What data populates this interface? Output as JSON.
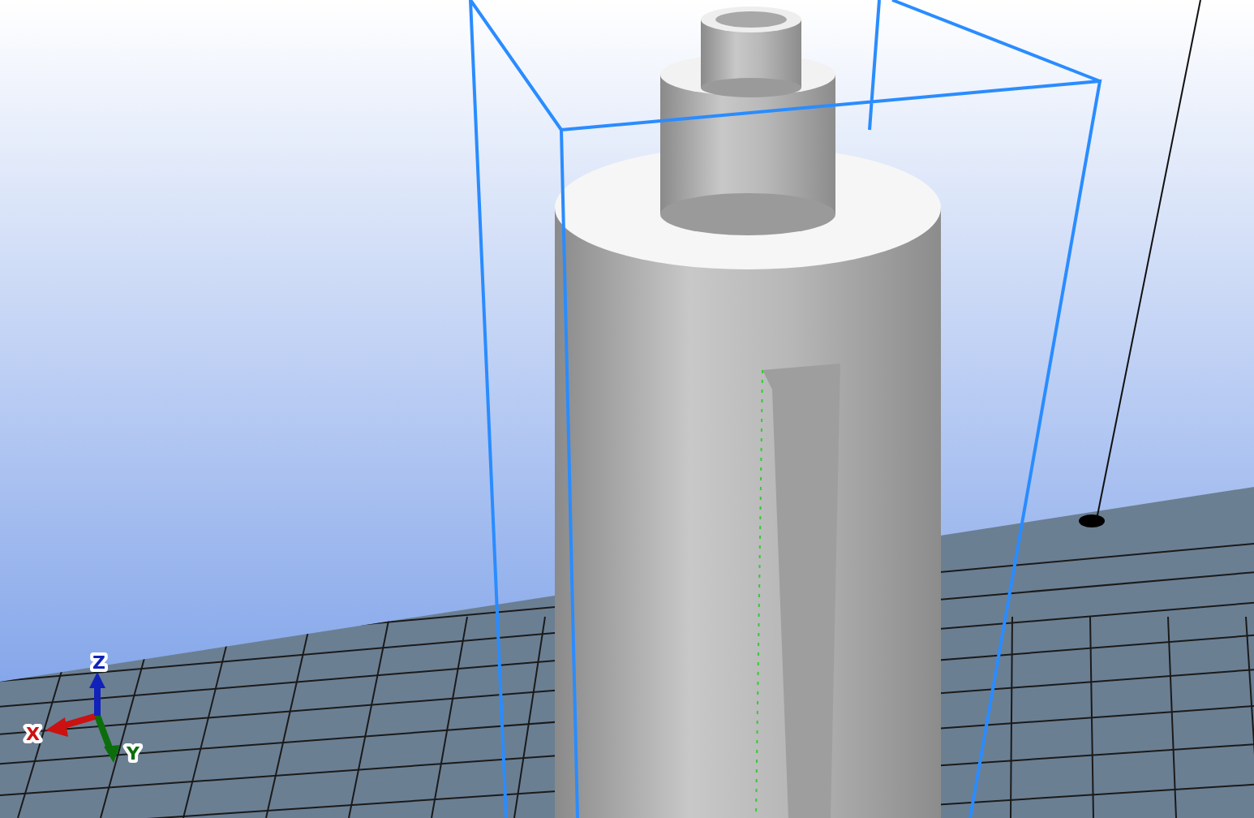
{
  "viewport": {
    "axes": [
      {
        "label": "X",
        "color": "#cc1111"
      },
      {
        "label": "Y",
        "color": "#0b6e0b"
      },
      {
        "label": "Z",
        "color": "#1122bb"
      }
    ]
  }
}
